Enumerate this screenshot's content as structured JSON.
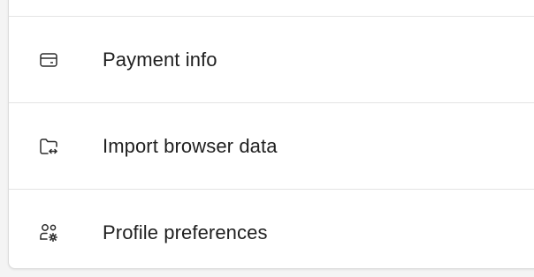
{
  "menu": {
    "items": [
      {
        "label": "Payment info",
        "icon": "credit-card-icon"
      },
      {
        "label": "Import browser data",
        "icon": "folder-import-icon"
      },
      {
        "label": "Profile preferences",
        "icon": "profile-settings-icon"
      }
    ]
  }
}
